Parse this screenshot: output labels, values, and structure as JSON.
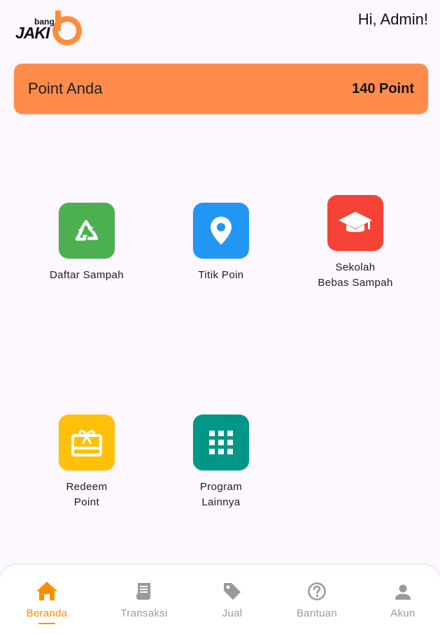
{
  "header": {
    "logo": {
      "small_text": "bang",
      "main_text": "JAKI",
      "badge_letter": "b",
      "accent_color": "#ff8c3a"
    },
    "greeting": "Hi, Admin!"
  },
  "points_card": {
    "label": "Point Anda",
    "value": "140 Point",
    "background_color": "#ff8c4b"
  },
  "menu": {
    "items": [
      {
        "label": "Daftar Sampah",
        "icon": "recycle-icon",
        "color": "#4caf50"
      },
      {
        "label": "Titik Poin",
        "icon": "location-pin-icon",
        "color": "#2196f3"
      },
      {
        "label": "Sekolah\nBebas Sampah",
        "icon": "graduation-cap-icon",
        "color": "#f44336"
      },
      {
        "label": "Redeem\nPoint",
        "icon": "gift-card-icon",
        "color": "#ffc107"
      },
      {
        "label": "Program\nLainnya",
        "icon": "grid-apps-icon",
        "color": "#009688"
      }
    ]
  },
  "bottom_nav": {
    "active_color": "#ff8f00",
    "inactive_color": "#9a9a9a",
    "active_index": 0,
    "items": [
      {
        "label": "Beranda",
        "icon": "home-icon"
      },
      {
        "label": "Transaksi",
        "icon": "receipt-icon"
      },
      {
        "label": "Jual",
        "icon": "tag-icon"
      },
      {
        "label": "Bantuan",
        "icon": "help-circle-icon"
      },
      {
        "label": "Akun",
        "icon": "person-icon"
      }
    ]
  }
}
